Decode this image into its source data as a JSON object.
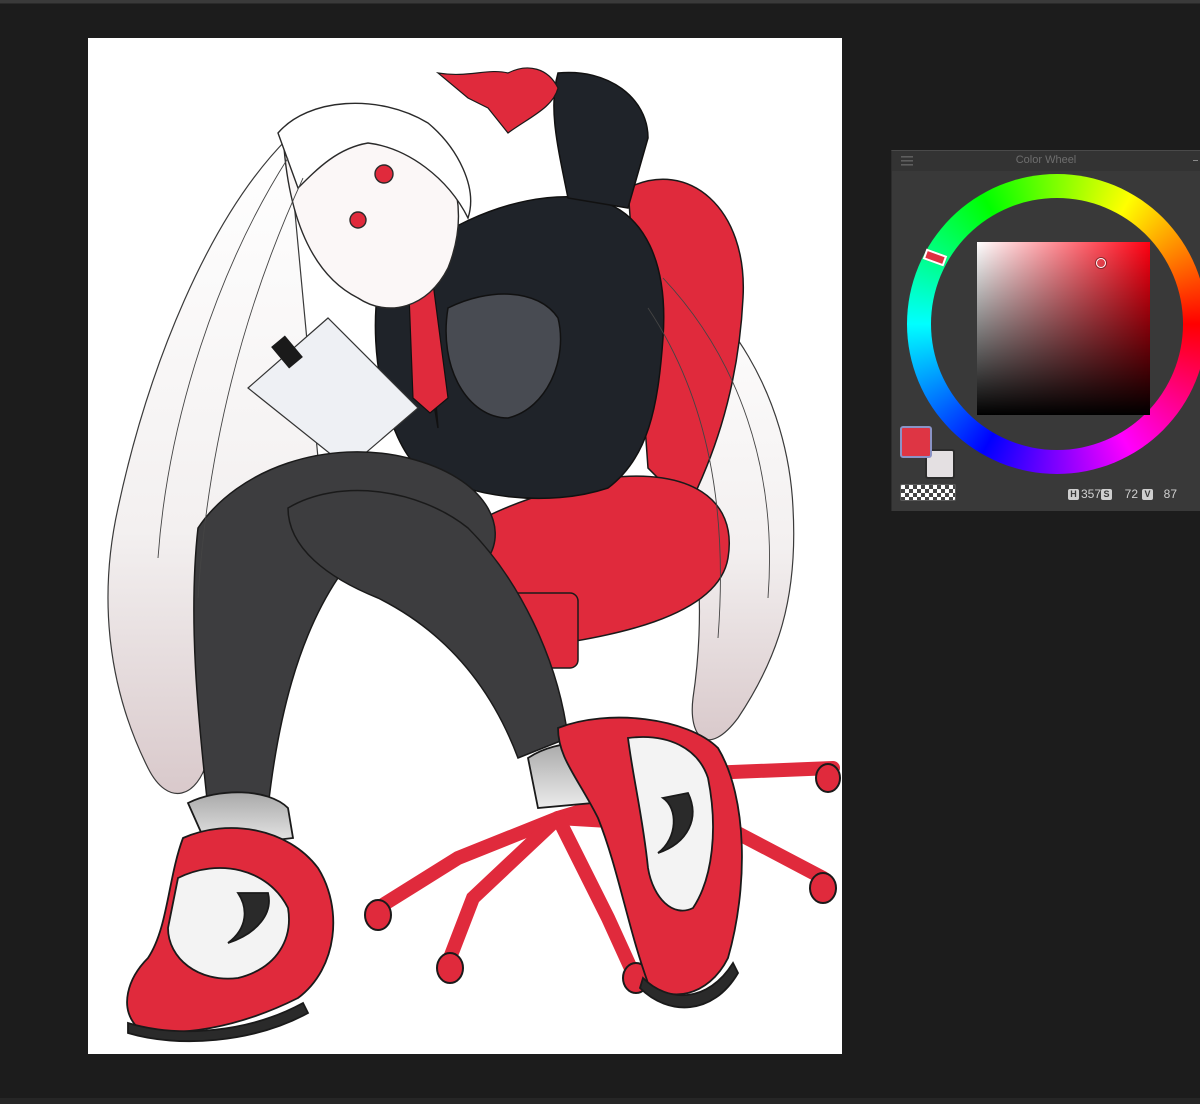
{
  "window": {
    "panel_title": "Color Wheel"
  },
  "colors": {
    "main_color": "#de3544",
    "sub_color": "#e4e0e2",
    "canvas_bg": "#ffffff",
    "workspace_bg": "#1c1c1c",
    "panel_bg": "#393939",
    "accent_red": "#e02a3c",
    "dark_cloth": "#1f2329",
    "tights": "#3d3d3f",
    "hair": "#f1efef"
  },
  "color_wheel": {
    "hue_label": "H",
    "hue_value": "357",
    "saturation_label": "S",
    "saturation_value": "72",
    "value_label": "V",
    "value_value": "87"
  },
  "icons": {
    "panel_menu": "hamburger-menu-icon",
    "transparent_swatch": "checkerboard-icon"
  }
}
